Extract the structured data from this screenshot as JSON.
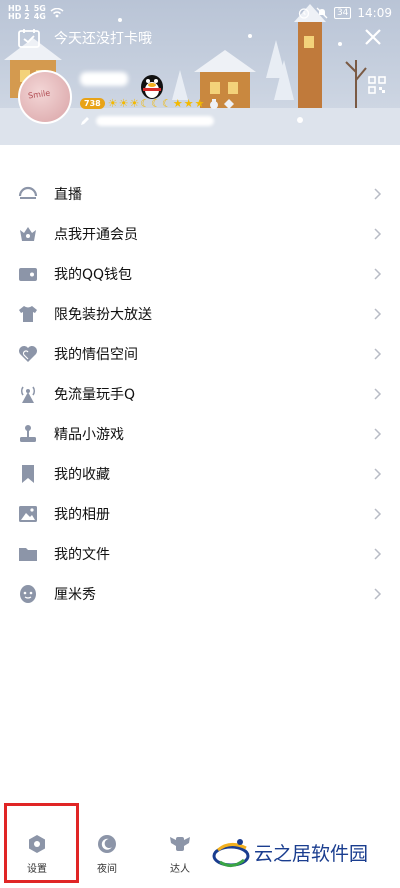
{
  "status_bar": {
    "hd_top": "HD 1",
    "hd_bottom": "HD 2",
    "net_top": "5G",
    "net_bottom": "4G",
    "battery": "34",
    "time": "14:09"
  },
  "header": {
    "checkin_text": "今天还没打卡哦",
    "avatar_text": "Smile",
    "vip_badge": "738",
    "level_glyphs": "☀☀☀☾☾☾★★★"
  },
  "menu": {
    "items": [
      {
        "label": "直播",
        "icon": "live-icon"
      },
      {
        "label": "点我开通会员",
        "icon": "vip-crown-icon"
      },
      {
        "label": "我的QQ钱包",
        "icon": "wallet-icon"
      },
      {
        "label": "限免装扮大放送",
        "icon": "shirt-icon"
      },
      {
        "label": "我的情侣空间",
        "icon": "heart-icon"
      },
      {
        "label": "免流量玩手Q",
        "icon": "antenna-icon"
      },
      {
        "label": "精品小游戏",
        "icon": "joystick-icon"
      },
      {
        "label": "我的收藏",
        "icon": "bookmark-icon"
      },
      {
        "label": "我的相册",
        "icon": "photo-icon"
      },
      {
        "label": "我的文件",
        "icon": "folder-icon"
      },
      {
        "label": "厘米秀",
        "icon": "face-icon"
      }
    ]
  },
  "bottom_bar": {
    "settings": "设置",
    "night": "夜间",
    "expert": "达人"
  },
  "watermark": {
    "text": "云之居软件园"
  },
  "colors": {
    "icon_gray": "#8c95a8",
    "highlight_red": "#e02525",
    "watermark_blue": "#1a3d8f",
    "vip_gold": "#e8a317"
  }
}
